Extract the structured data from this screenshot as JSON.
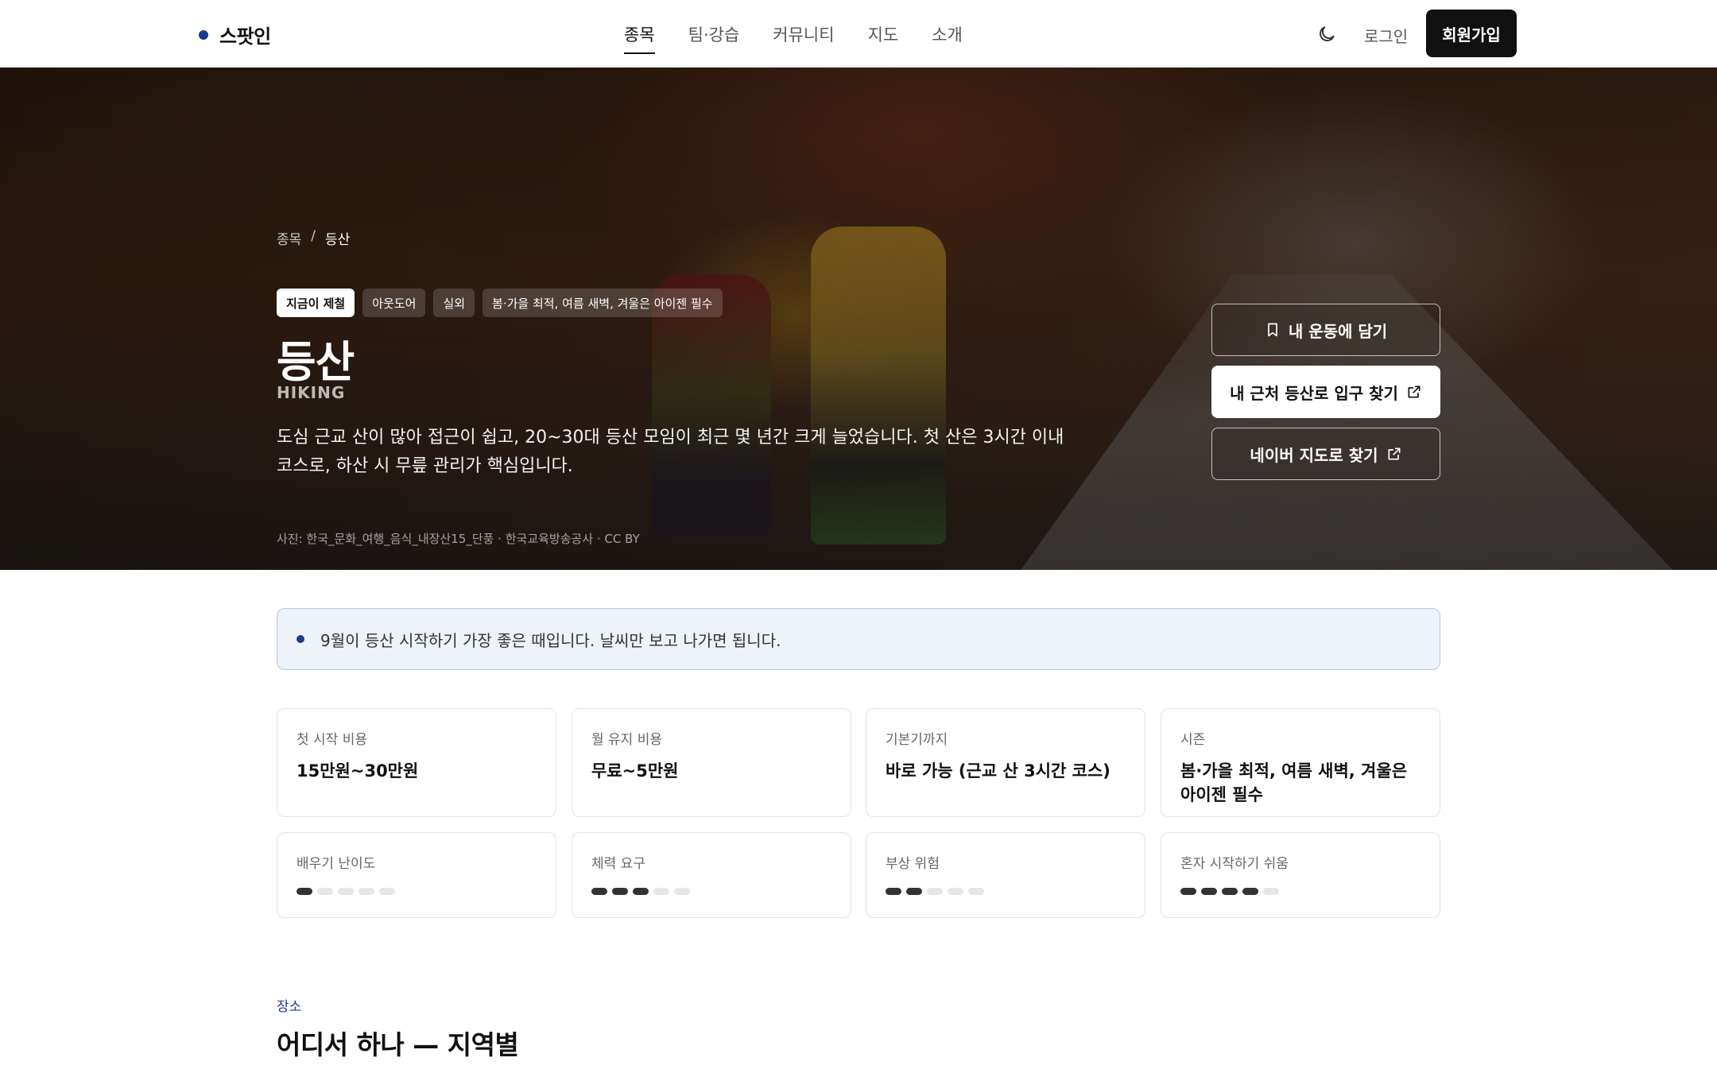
{
  "header": {
    "brand": "스팟인",
    "nav": [
      {
        "label": "종목",
        "active": true
      },
      {
        "label": "팀·강습",
        "active": false
      },
      {
        "label": "커뮤니티",
        "active": false
      },
      {
        "label": "지도",
        "active": false
      },
      {
        "label": "소개",
        "active": false
      }
    ],
    "theme_icon": "moon-icon",
    "login": "로그인",
    "signup": "회원가입"
  },
  "hero": {
    "breadcrumb": {
      "root": "종목",
      "sep": "/",
      "current": "등산"
    },
    "tags": [
      "지금이 제철",
      "아웃도어",
      "실외",
      "봄·가을 최적, 여름 새벽, 겨울은 아이젠 필수"
    ],
    "title": "등산",
    "subtitle": "HIKING",
    "description": "도심 근교 산이 많아 접근이 쉽고, 20~30대 등산 모임이 최근 몇 년간 크게 늘었습니다. 첫 산은 3시간 이내 코스로, 하산 시 무릎 관리가 핵심입니다.",
    "credit": "사진: 한국_문화_여행_음식_내장산15_단풍 · 한국교육방송공사 · CC BY",
    "buttons": {
      "save": "내 운동에 담기",
      "nearby": "내 근처 등산로 입구 찾기",
      "naver": "네이버 지도로 찾기"
    }
  },
  "notice": {
    "text": "9월이 등산 시작하기 가장 좋은 때입니다. 날씨만 보고 나가면 됩니다."
  },
  "info": [
    {
      "label": "첫 시작 비용",
      "value": "15만원~30만원"
    },
    {
      "label": "월 유지 비용",
      "value": "무료~5만원"
    },
    {
      "label": "기본기까지",
      "value": "바로 가능 (근교 산 3시간 코스)"
    },
    {
      "label": "시즌",
      "value": "봄·가을 최적, 여름 새벽, 겨울은 아이젠 필수"
    }
  ],
  "ratings": [
    {
      "label": "배우기 난이도",
      "level": 1,
      "max": 5
    },
    {
      "label": "체력 요구",
      "level": 3,
      "max": 5
    },
    {
      "label": "부상 위험",
      "level": 2,
      "max": 5
    },
    {
      "label": "혼자 시작하기 쉬움",
      "level": 4,
      "max": 5
    }
  ],
  "section": {
    "label": "장소",
    "title": "어디서 하나 — 지역별"
  },
  "colors": {
    "accent": "#1f3a8a",
    "notice_bg": "#eef2f9",
    "dark": "#111111"
  }
}
